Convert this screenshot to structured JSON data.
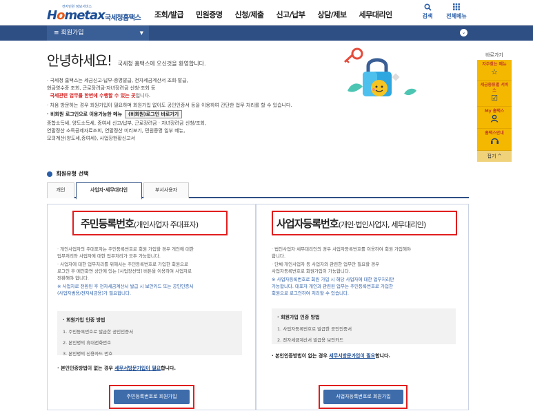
{
  "header": {
    "logo_tag": "전자민원 정보서비스",
    "logo_text_pre": "H",
    "logo_text_o": "o",
    "logo_text_post": "metax",
    "logo_sub": "국세청홈택스",
    "nav": [
      "조회/발급",
      "민원증명",
      "신청/제출",
      "신고/납부",
      "상담/제보",
      "세무대리인"
    ],
    "search_label": "검색",
    "allmenu_label": "전체메뉴"
  },
  "bluebar": {
    "menu_label": "≡  회원가입"
  },
  "welcome": {
    "title": "안녕하세요!",
    "subtitle": "국세청 홈택스에 오신것을 환영합니다."
  },
  "intro": {
    "line1": "· 국세청 홈택스는 세금신고·납부·증명발급, 전자세금계산서 조회·발급,",
    "line2": "  현금영수증 조회, 근로장려금·자녀장려금 신청·조회 등",
    "line3": "국세관련 업무를 한번에 수행할 수 있는 곳",
    "line3_suffix": "입니다.",
    "line4": "· 처음 방문하는 경우 회원가입이 필요하며 회원가입 없이도 공인인증서 등을 이용하여 간단한 업무 처리를 할 수 있습니다.",
    "line5_label": "· 비회원 로그인으로 이용가능한 메뉴",
    "line5_button": "(비회원)로그인 바로가기",
    "line6": "  종합소득세, 양도소득세, 증여세 신고/납부, 근로장려금 · 자녀장려금 신청/조회,",
    "line7": "  연말정산 소득공제자료조회, 연말정산 미리보기, 민원증명 일부 메뉴,",
    "line8": "  모의계산(양도세,증여세), 사업장현황신고서"
  },
  "quick": {
    "title": "바로가기",
    "items": [
      {
        "label": "자주찾는 메뉴",
        "icon": "star-icon"
      },
      {
        "label": "세금종류별 서비스",
        "icon": "check-icon"
      },
      {
        "label": "My 홈택스",
        "icon": "person-icon"
      },
      {
        "label": "홈택스안내",
        "icon": "help-icon"
      }
    ],
    "close_label": "접기 ^"
  },
  "member_type": {
    "label": "회원유형 선택",
    "tabs": [
      "개인",
      "사업자·세무대리인",
      "부서사용자"
    ],
    "active_tab": 1
  },
  "left_panel": {
    "title_big": "주민등록번호",
    "title_small": "(개인사업자 주대표자)",
    "desc": [
      "· 개인사업자의 주대표자는 주민등록번호로 회원 가입할 경우 개인에 대한",
      "  업무처리와 사업자에 대한 업무처리가 모두 가능합니다.",
      "· 사업자에 대한 업무처리를 위해서는 주민등록번호로 가입한 회원으로",
      "  로그인 후 메인화면 상단에 있는 [사업장선택] 버튼을 이용하여 사업자로",
      "  전환해야 합니다."
    ],
    "notes": [
      "※ 사업자로 전환된 후 전자세금계산서 발급 시 보안카드 또는 공인인증서",
      "   (사업자범용/전자세금용)가 필요합니다."
    ],
    "auth_title": "· 회원가입 인증 방법",
    "auth_items": [
      "1. 주민등록번호로 발급한 공인인증서",
      "2. 본인명의 휴대전화번호",
      "3. 본인명의 신용카드 번호"
    ],
    "noauth_pre": "· 본인인증방법이 없는 경우 ",
    "noauth_link": "세무서방문가입이 필요",
    "noauth_post": "합니다.",
    "button": "주민등록번호로 회원가입"
  },
  "right_panel": {
    "title_big": "사업자등록번호",
    "title_small": "(개인·법인사업자, 세무대리인)",
    "desc": [
      "· 법인사업자·세무대리인의 경우 사업자등록번호를 이용하여 회원 가입해야",
      "  합니다.",
      "· 단체·개인사업자 등 사업자와 관련한 업무만 필요할 경우",
      "  사업자등록번호로 회원가입이 가능합니다."
    ],
    "notes": [
      "※ 사업자등록번호로 회원 가입 시 해당 사업자에 대한 업무처리만",
      "   가능합니다. 대표자 개인과 관련된 업무는 주민등록번호로 가입한",
      "   회원으로 로그인하여 처리할 수 있습니다."
    ],
    "auth_title": "· 회원가입 인증 방법",
    "auth_items": [
      "1. 사업자등록번호로 발급한 공인인증서",
      "2. 전자세금계산서 발급용 보안카드"
    ],
    "noauth_pre": "· 본인인증방법이 없는 경우 ",
    "noauth_link": "세무서방문가입이 필요",
    "noauth_post": "합니다.",
    "button": "사업자등록번호로 회원가입"
  },
  "colors": {
    "brand_blue": "#2e4f84",
    "highlight_red": "#e21d1d",
    "quick_yellow": "#f5b800",
    "button_blue": "#3e6cab"
  }
}
